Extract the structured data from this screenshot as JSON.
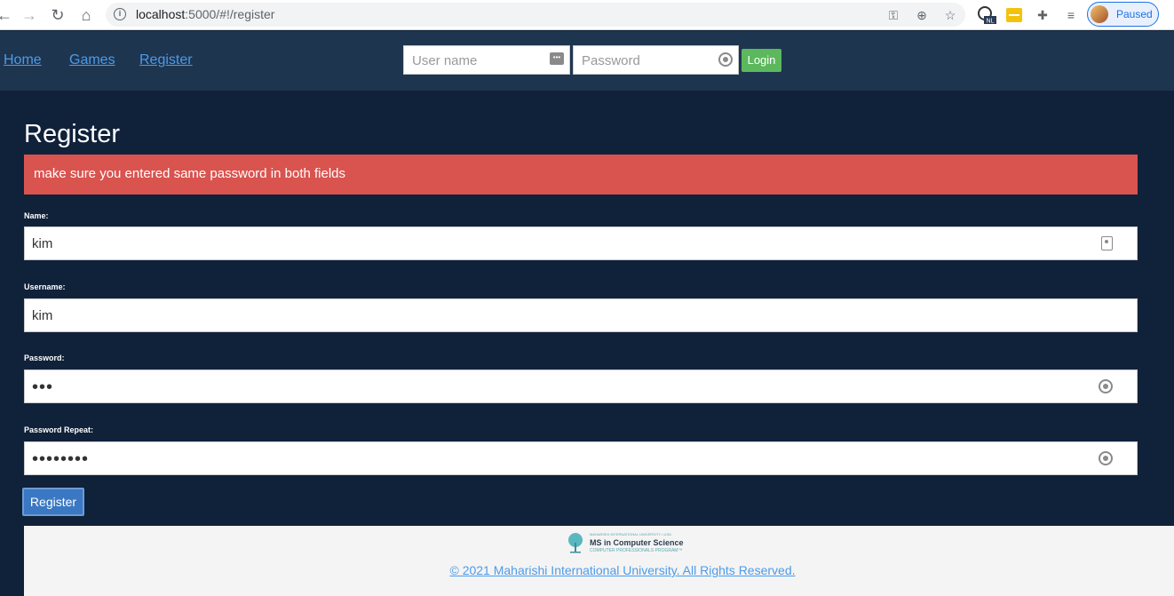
{
  "browser": {
    "url_host": "localhost",
    "url_rest": ":5000/#!/register",
    "profile_status": "Paused",
    "ext_badge": "NL"
  },
  "header": {
    "nav": [
      "Home",
      "Games",
      "Register"
    ],
    "username_placeholder": "User name",
    "password_placeholder": "Password",
    "login_label": "Login"
  },
  "main": {
    "title": "Register",
    "alert": "make sure you entered same password in both fields",
    "name_label": "Name:",
    "name_value": "kim",
    "username_label": "Username:",
    "username_value": "kim",
    "password_label": "Password:",
    "password_dots": "•••",
    "password_repeat_label": "Password Repeat:",
    "password_repeat_dots": "••••••••",
    "register_label": "Register"
  },
  "footer": {
    "logo_line1": "MAHARISHI INTERNATIONAL UNIVERSITY • USA",
    "logo_line2": "MS in Computer Science",
    "logo_line3": "COMPUTER PROFESSIONALS PROGRAM™",
    "copyright": "© 2021 Maharishi International University. All Rights Reserved."
  },
  "colors": {
    "page_bg": "#10213a",
    "header_bg": "#1e3550",
    "alert_bg": "#d9534f",
    "login_btn": "#5cb85c",
    "register_btn": "#3a78c3",
    "link": "#4d9be8"
  }
}
